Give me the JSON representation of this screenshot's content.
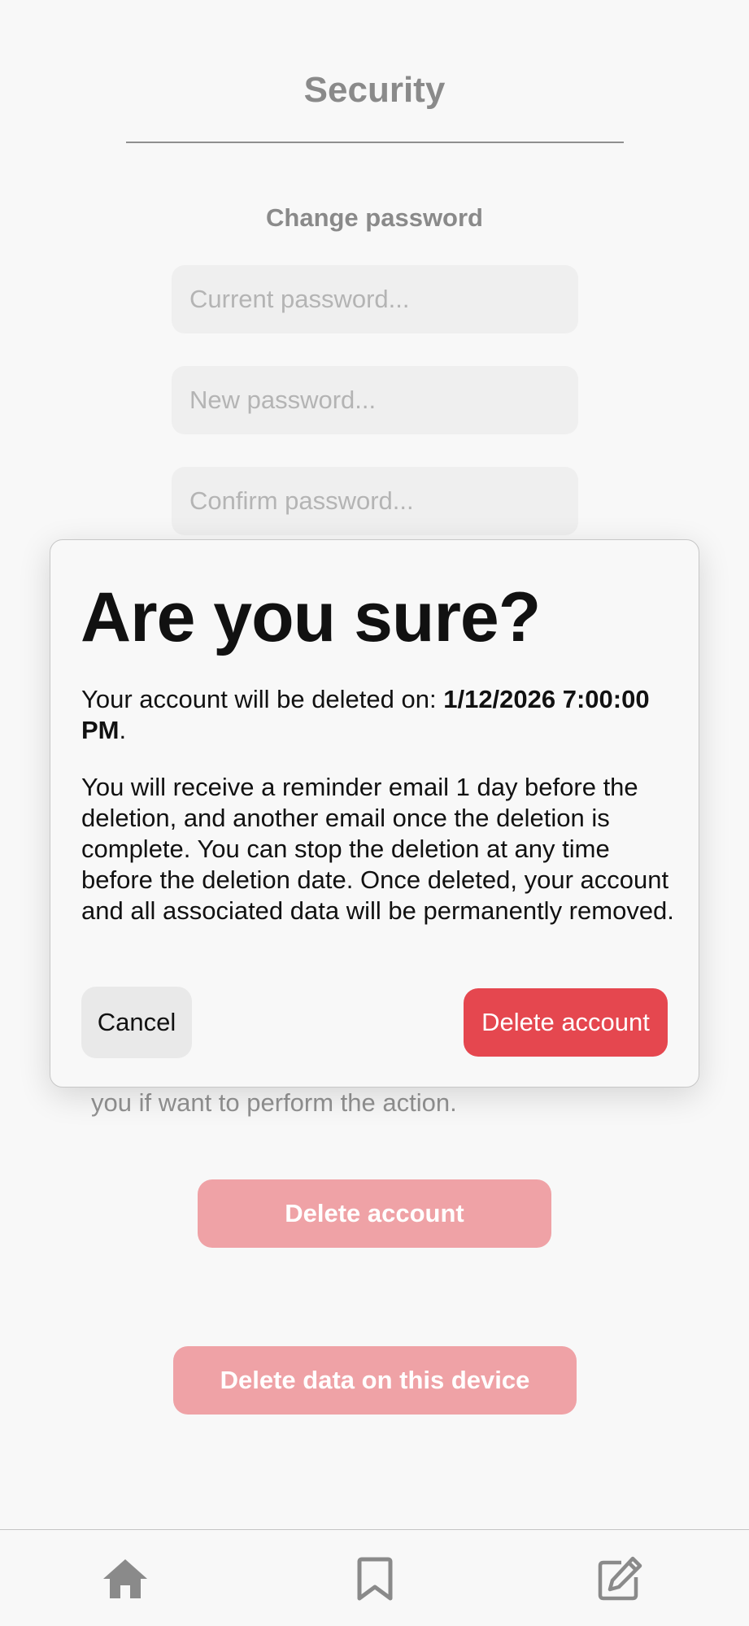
{
  "page": {
    "title": "Security",
    "change_password": {
      "heading": "Change password",
      "current_placeholder": "Current password...",
      "new_placeholder": "New password...",
      "confirm_placeholder": "Confirm password..."
    },
    "partial_text": "you if want to perform the action.",
    "delete_account_label": "Delete account",
    "delete_device_label": "Delete data on this device"
  },
  "modal": {
    "title": "Are you sure?",
    "date_prefix": "Your account will be deleted on: ",
    "date_value": "1/12/2026 7:00:00 PM",
    "date_suffix": ".",
    "body": "You will receive a reminder email 1 day before the deletion, and another email once the deletion is complete. You can stop the deletion at any time before the deletion date. Once deleted, your account and all associated data will be permanently removed.",
    "cancel_label": "Cancel",
    "confirm_label": "Delete account"
  },
  "tabbar": {
    "items": [
      {
        "icon": "home-icon"
      },
      {
        "icon": "bookmark-icon"
      },
      {
        "icon": "compose-icon"
      }
    ]
  },
  "colors": {
    "background": "#f8f8f8",
    "danger": "#e5474f",
    "danger_faded": "#efa2a6",
    "muted_text": "#8a8a8a",
    "input_bg": "#efefef"
  }
}
